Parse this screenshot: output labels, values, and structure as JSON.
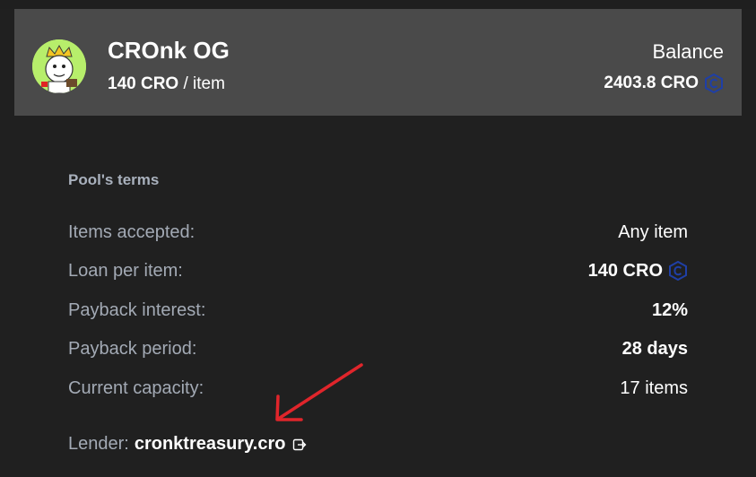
{
  "header": {
    "collection_name": "CROnk OG",
    "price_amount": "140 CRO",
    "price_unit": " / item",
    "balance_label": "Balance",
    "balance_value": "2403.8 CRO"
  },
  "terms": {
    "title": "Pool's terms",
    "rows": [
      {
        "label": "Items accepted:",
        "value": "Any item"
      },
      {
        "label": "Loan per item:",
        "value": "140 CRO"
      },
      {
        "label": "Payback interest:",
        "value": "12%"
      },
      {
        "label": "Payback period:",
        "value": "28 days"
      },
      {
        "label": "Current capacity:",
        "value": "17 items"
      }
    ],
    "lender_label": "Lender:",
    "lender_name": "cronktreasury.cro"
  },
  "icons": {
    "currency": "cro-coin-icon",
    "external": "external-link-icon",
    "annotation": "red-arrow-annotation"
  },
  "colors": {
    "background": "#202020",
    "header_card": "#4a4a4a",
    "avatar_bg": "#b7ee6b",
    "cro_icon": "#1f3fa6",
    "label_text": "#a3aab5",
    "value_text": "#ffffff",
    "annotation": "#e0252b"
  }
}
